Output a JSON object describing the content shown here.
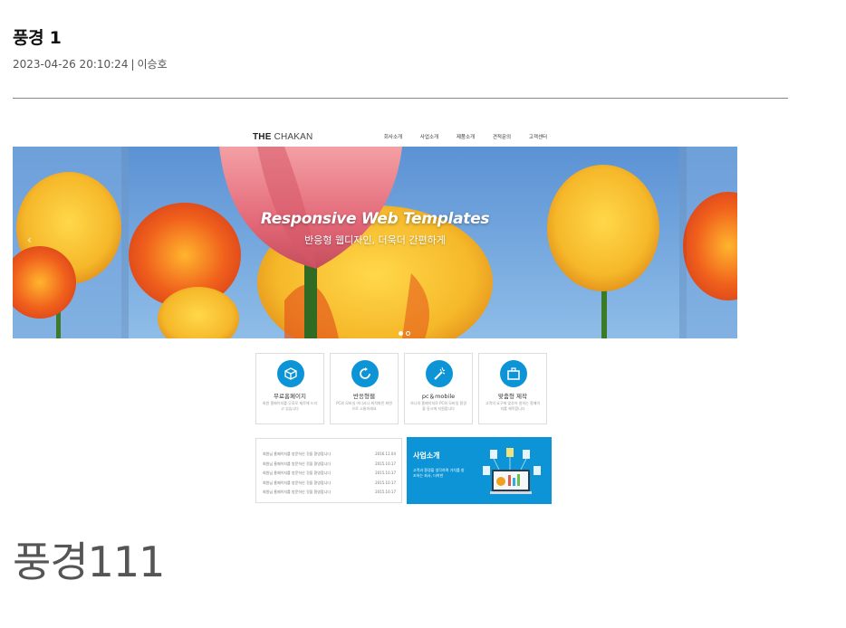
{
  "post": {
    "title": "풍경 1",
    "date": "2023-04-26 20:10:24",
    "separator": "|",
    "author": "이승호"
  },
  "site": {
    "logo_bold": "THE",
    "logo_light": "CHAKAN",
    "nav": [
      "회사소개",
      "사업소개",
      "제품소개",
      "견적문의",
      "고객센터"
    ],
    "hero": {
      "title": "Responsive Web Templates",
      "subtitle": "반응형 웹디자인, 더욱더 간편하게",
      "prev_arrow": "‹"
    },
    "features": [
      {
        "name": "무료홈페이지",
        "desc": "회원 홈페이지를 무료로 제작해 드리고 있습니다"
      },
      {
        "name": "반응형웹",
        "desc": "PC와 모바일 어디서나 최적화된 화면으로 소통하세요"
      },
      {
        "name": "pc＆mobile",
        "desc": "하나의 홈페이지로 PC와 모바일 환경을 동시에 지원합니다"
      },
      {
        "name": "맞춤형 제작",
        "desc": "고객의 요구에 맞추어 원하는 홈페이지를 제작합니다"
      }
    ],
    "news": [
      {
        "text": "회원님 홈페이지를 방문하신 것을 환영합니다",
        "date": "2016.11.04"
      },
      {
        "text": "회원님 홈페이지를 방문하신 것을 환영합니다",
        "date": "2015.10.17"
      },
      {
        "text": "회원님 홈페이지를 방문하신 것을 환영합니다",
        "date": "2015.10.17"
      },
      {
        "text": "회원님 홈페이지를 방문하신 것을 환영합니다",
        "date": "2015.10.17"
      },
      {
        "text": "회원님 홈페이지를 방문하신 것을 환영합니다",
        "date": "2015.10.17"
      }
    ],
    "business": {
      "title": "사업소개",
      "desc": "고객과 환경을 생각하며 가치를 창조하는 회사, 더착한"
    }
  },
  "footer_heading": "풍경111",
  "colors": {
    "accent": "#0c94d6",
    "sky": "#6a9fd6"
  }
}
